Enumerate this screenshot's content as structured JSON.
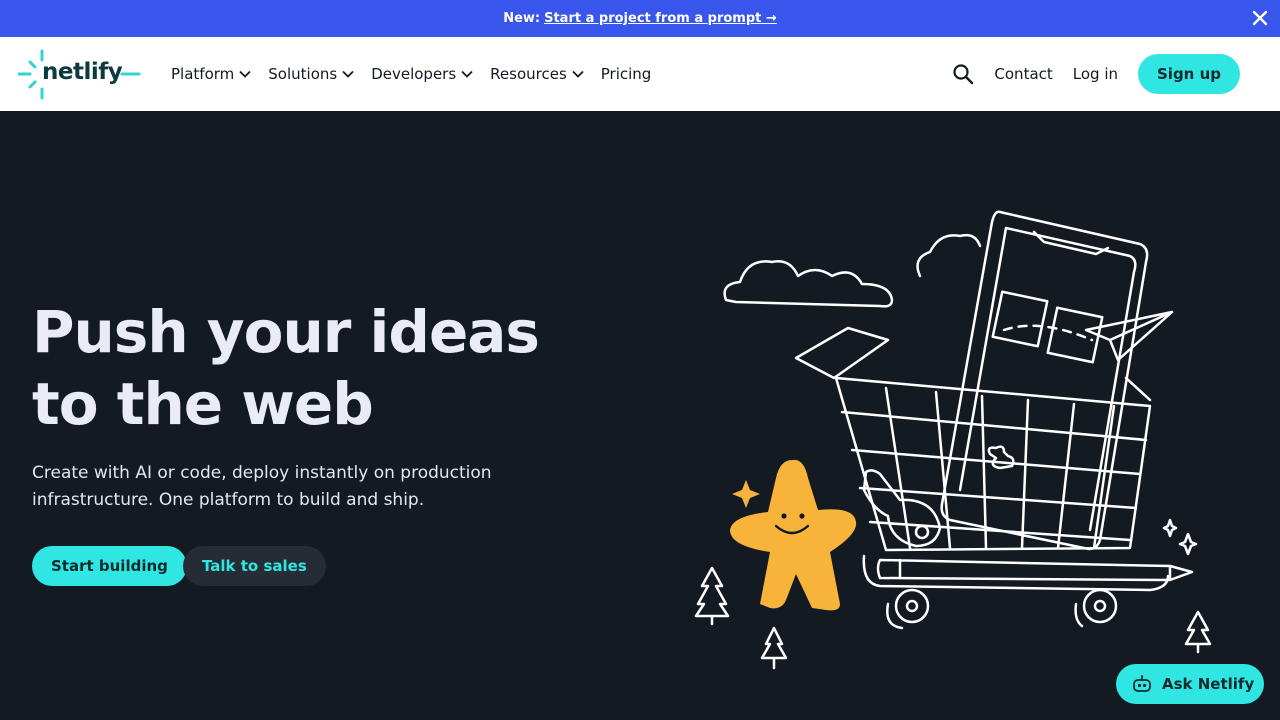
{
  "announcement": {
    "prefix": "New:",
    "link_text": "Start a project from a prompt →"
  },
  "header": {
    "logo_text": "netlify",
    "nav": [
      {
        "label": "Platform"
      },
      {
        "label": "Solutions"
      },
      {
        "label": "Developers"
      },
      {
        "label": "Resources"
      },
      {
        "label": "Pricing"
      }
    ],
    "contact": "Contact",
    "login": "Log in",
    "signup": "Sign up"
  },
  "hero": {
    "title_line1": "Push your ideas",
    "title_line2": "to the web",
    "subtitle": "Create with AI or code, deploy instantly on production infrastructure. One platform to build and ship.",
    "primary_button": "Start building",
    "secondary_button": "Talk to sales"
  },
  "ask": {
    "label": "Ask Netlify"
  },
  "colors": {
    "accent": "#30e6e2",
    "announcement_bg": "#3855ec",
    "hero_bg": "#141a21",
    "mascot": "#f8b43a"
  },
  "icons": [
    "close-icon",
    "netlify-logo",
    "chevron-down-icon",
    "search-icon",
    "robot-icon"
  ]
}
